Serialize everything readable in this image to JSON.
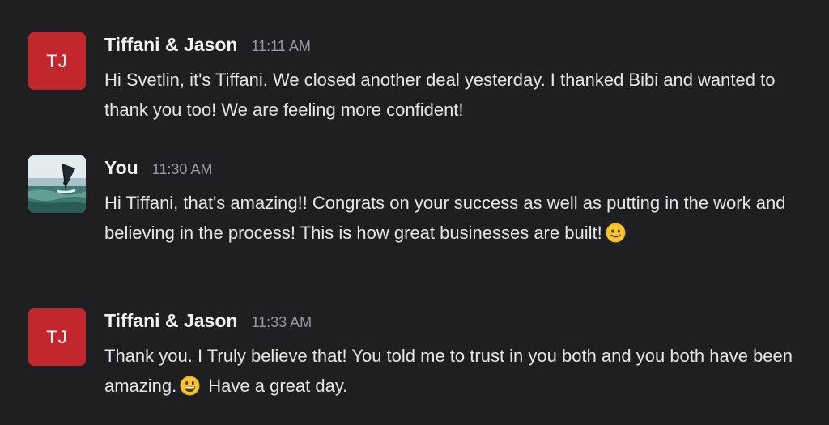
{
  "messages": [
    {
      "avatar_initials": "TJ",
      "avatar_color": "#c2272b",
      "sender": "Tiffani & Jason",
      "time": "11:11 AM",
      "text": "Hi Svetlin, it's Tiffani. We closed another deal yesterday. I thanked Bibi and wanted to thank you too! We are feeling more confident!"
    },
    {
      "avatar_image": "windsurfer-photo",
      "sender": "You",
      "time": "11:30 AM",
      "text": "Hi Tiffani, that's amazing!! Congrats on your success as well as putting in the work and believing in the process! This is how great businesses are built!",
      "emoji": "slightly-smiling-face-icon"
    },
    {
      "avatar_initials": "TJ",
      "avatar_color": "#c2272b",
      "sender": "Tiffani & Jason",
      "time": "11:33 AM",
      "text_before_emoji": "Thank you. I Truly believe that! You told me to trust in you both and you both have been amazing.",
      "emoji": "grinning-face-icon",
      "text_after_emoji": "Have a great day."
    }
  ]
}
